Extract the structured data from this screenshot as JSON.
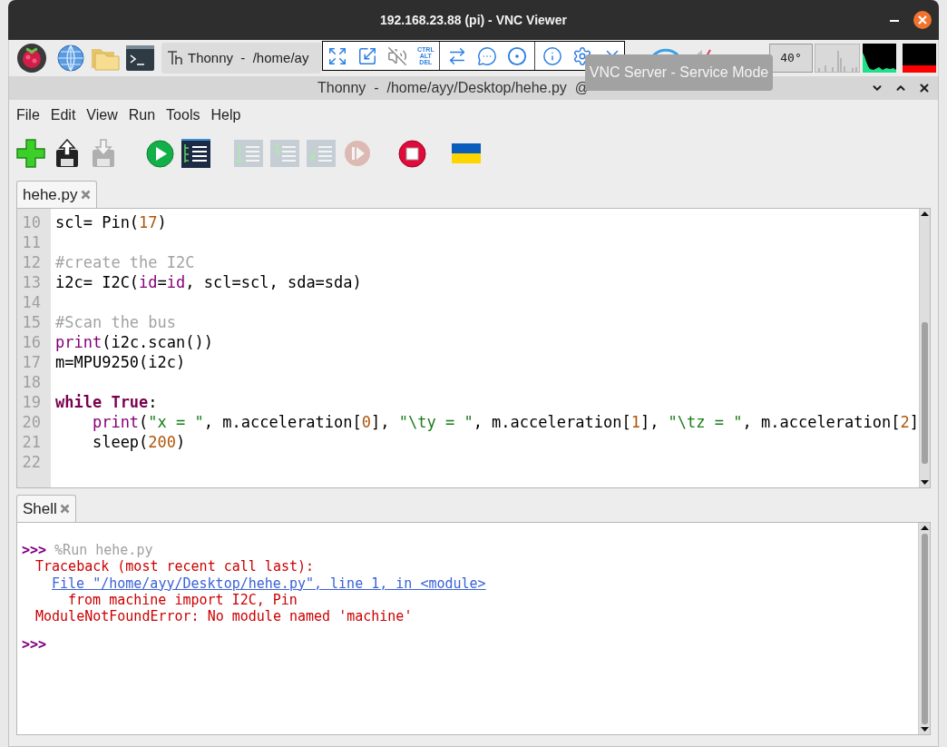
{
  "vnc_window": {
    "title": "192.168.23.88 (pi) - VNC Viewer"
  },
  "taskbar": {
    "task_button": "Thonny  -  /home/ay",
    "temperature": "40°"
  },
  "vnc_toolbar": {
    "ctrl_alt_del": [
      "CTRL",
      "ALT",
      "DEL"
    ]
  },
  "tooltip": "VNC Server - Service Mode",
  "thonny": {
    "title": "Thonny  -  /home/ayy/Desktop/hehe.py  @",
    "menu": [
      "File",
      "Edit",
      "View",
      "Run",
      "Tools",
      "Help"
    ],
    "toolbar": [
      {
        "kind": "new",
        "disabled": false
      },
      {
        "kind": "load",
        "disabled": false
      },
      {
        "kind": "save",
        "disabled": true
      },
      {
        "kind": "run",
        "disabled": false
      },
      {
        "kind": "debug",
        "disabled": false
      },
      {
        "kind": "step_over",
        "disabled": true
      },
      {
        "kind": "step_into",
        "disabled": true
      },
      {
        "kind": "step_out",
        "disabled": true
      },
      {
        "kind": "resume",
        "disabled": true
      },
      {
        "kind": "stop",
        "disabled": false
      },
      {
        "kind": "flag",
        "disabled": false
      }
    ],
    "editor": {
      "tab": {
        "label": "hehe.py",
        "selected": true
      },
      "lines": [
        {
          "number": "10",
          "tokens": [
            {
              "kind": "plain",
              "text": "scl= Pin("
            },
            {
              "kind": "number",
              "text": "17"
            },
            {
              "kind": "plain",
              "text": ")"
            }
          ]
        },
        {
          "number": "11"
        },
        {
          "number": "12",
          "tokens": [
            {
              "kind": "comment",
              "text": "#create the I2C"
            }
          ]
        },
        {
          "number": "13",
          "tokens": [
            {
              "kind": "plain",
              "text": "i2c= I2C("
            },
            {
              "kind": "param",
              "text": "id"
            },
            {
              "kind": "plain",
              "text": "="
            },
            {
              "kind": "param",
              "text": "id"
            },
            {
              "kind": "plain",
              "text": ", scl=scl, sda=sda)"
            }
          ]
        },
        {
          "number": "14"
        },
        {
          "number": "15",
          "tokens": [
            {
              "kind": "comment",
              "text": "#Scan the bus"
            }
          ]
        },
        {
          "number": "16",
          "tokens": [
            {
              "kind": "builtin",
              "text": "print"
            },
            {
              "kind": "plain",
              "text": "(i2c.scan())"
            }
          ]
        },
        {
          "number": "17",
          "tokens": [
            {
              "kind": "plain",
              "text": "m=MPU9250(i2c)"
            }
          ]
        },
        {
          "number": "18"
        },
        {
          "number": "19",
          "tokens": [
            {
              "kind": "keyword",
              "text": "while True"
            },
            {
              "kind": "plain",
              "text": ":"
            }
          ],
          "children": [
            {
              "number": "20",
              "tokens": [
                {
                  "kind": "builtin",
                  "text": "print"
                },
                {
                  "kind": "plain",
                  "text": "("
                },
                {
                  "kind": "string",
                  "text": "\"x = \""
                },
                {
                  "kind": "plain",
                  "text": ", m.acceleration["
                },
                {
                  "kind": "number",
                  "text": "0"
                },
                {
                  "kind": "plain",
                  "text": "], "
                },
                {
                  "kind": "string",
                  "text": "\"\\ty = \""
                },
                {
                  "kind": "plain",
                  "text": ", m.acceleration["
                },
                {
                  "kind": "number",
                  "text": "1"
                },
                {
                  "kind": "plain",
                  "text": "], "
                },
                {
                  "kind": "string",
                  "text": "\"\\tz = \""
                },
                {
                  "kind": "plain",
                  "text": ", m.acceleration["
                },
                {
                  "kind": "number",
                  "text": "2"
                },
                {
                  "kind": "plain",
                  "text": "]"
                }
              ]
            },
            {
              "number": "21",
              "tokens": [
                {
                  "kind": "plain",
                  "text": "sleep("
                },
                {
                  "kind": "number",
                  "text": "200"
                },
                {
                  "kind": "plain",
                  "text": ")"
                }
              ]
            }
          ]
        },
        {
          "number": "22"
        }
      ]
    },
    "shell": {
      "tab": {
        "label": "Shell",
        "selected": true
      },
      "lines": [
        {
          "kind": "command",
          "prompt": ">>>",
          "text": "%Run hehe.py"
        },
        {
          "kind": "error",
          "text": "Traceback (most recent call last):"
        },
        {
          "kind": "link",
          "text": "File \"/home/ayy/Desktop/hehe.py\", line 1, in <module>"
        },
        {
          "kind": "error_code",
          "text": "from machine import I2C, Pin"
        },
        {
          "kind": "error",
          "text": "ModuleNotFoundError: No module named 'machine'"
        },
        {
          "kind": "prompt",
          "prompt": ">>>"
        }
      ]
    }
  }
}
